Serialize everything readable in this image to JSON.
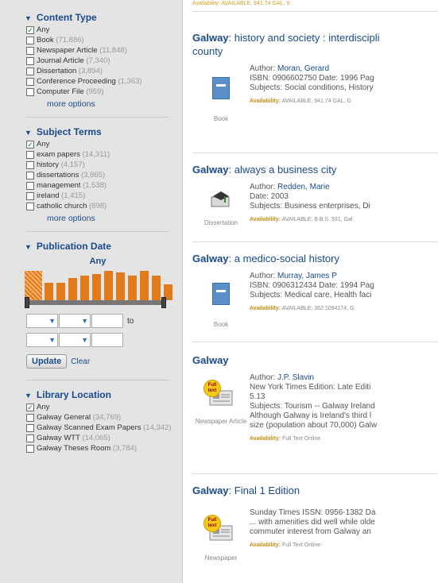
{
  "sidebar": {
    "content_type": {
      "title": "Content Type",
      "options": [
        {
          "label": "Any",
          "count": "",
          "checked": true
        },
        {
          "label": "Book",
          "count": "(71,886)",
          "checked": false
        },
        {
          "label": "Newspaper Article",
          "count": "(11,848)",
          "checked": false
        },
        {
          "label": "Journal Article",
          "count": "(7,340)",
          "checked": false
        },
        {
          "label": "Dissertation",
          "count": "(3,894)",
          "checked": false
        },
        {
          "label": "Conference Proceeding",
          "count": "(1,363)",
          "checked": false
        },
        {
          "label": "Computer File",
          "count": "(959)",
          "checked": false
        }
      ],
      "more": "more options"
    },
    "subject_terms": {
      "title": "Subject Terms",
      "options": [
        {
          "label": "Any",
          "count": "",
          "checked": true
        },
        {
          "label": "exam papers",
          "count": "(14,311)",
          "checked": false
        },
        {
          "label": "history",
          "count": "(4,157)",
          "checked": false
        },
        {
          "label": "dissertations",
          "count": "(3,865)",
          "checked": false
        },
        {
          "label": "management",
          "count": "(1,538)",
          "checked": false
        },
        {
          "label": "ireland",
          "count": "(1,415)",
          "checked": false
        },
        {
          "label": "catholic church",
          "count": "(898)",
          "checked": false
        }
      ],
      "more": "more options"
    },
    "publication_date": {
      "title": "Publication Date",
      "range_label": "Any",
      "histogram": [
        1.0,
        0.6,
        0.6,
        0.75,
        0.85,
        0.9,
        1.0,
        0.95,
        0.85,
        1.0,
        0.85,
        0.55
      ],
      "to_label": "to",
      "update_label": "Update",
      "clear_label": "Clear"
    },
    "library_location": {
      "title": "Library Location",
      "options": [
        {
          "label": "Any",
          "count": "",
          "checked": true
        },
        {
          "label": "Galway General",
          "count": "(34,769)",
          "checked": false
        },
        {
          "label": "Galway Scanned Exam Papers",
          "count": "(14,342)",
          "checked": false
        },
        {
          "label": "Galway WTT",
          "count": "(14,065)",
          "checked": false
        },
        {
          "label": "Galway Theses Room",
          "count": "(3,784)",
          "checked": false
        }
      ]
    }
  },
  "results": {
    "top_strip": "Availability: AVAILABLE, 941.74 GAL, 9",
    "records": [
      {
        "title_hl": "Galway",
        "title_rest": ": history and society : interdiscipli",
        "title_line2": "county",
        "format": "Book",
        "icon": "book-icon",
        "author_label": "Author:",
        "author": "Moran, Gerard",
        "lines": [
          "ISBN: 0906602750 Date: 1996 Pag",
          "Subjects: Social conditions, History"
        ],
        "availability_label": "Availability:",
        "availability": "AVAILABLE, 941.74 GAL, G"
      },
      {
        "title_hl": "Galway",
        "title_rest": ": always a business city",
        "title_line2": "",
        "format": "Dissertation",
        "icon": "dissertation-icon",
        "author_label": "Author:",
        "author": "Redden, Marie",
        "lines": [
          "Date: 2003",
          "Subjects: Business enterprises, Di"
        ],
        "availability_label": "Availability:",
        "availability": "AVAILABLE, B.B.S. 931, Gal"
      },
      {
        "title_hl": "Galway",
        "title_rest": ": a medico-social history",
        "title_line2": "",
        "format": "Book",
        "icon": "book-icon",
        "author_label": "Author:",
        "author": "Murray, James P",
        "lines": [
          "ISBN: 0906312434 Date: 1994 Pag",
          "Subjects: Medical care, Health faci"
        ],
        "availability_label": "Availability:",
        "availability": "AVAILABLE, 362.1094174, G"
      },
      {
        "title_hl": "Galway",
        "title_rest": "",
        "title_line2": "",
        "format": "Newspaper Article",
        "icon": "newspaper-icon",
        "badge": "Full text",
        "author_label": "Author:",
        "author": "J.P. Slavin",
        "lines": [
          "New York Times Edition: Late Editi",
          "5.13",
          "Subjects: Tourism -- Galway Ireland",
          "Although Galway is Ireland's third l",
          "size (population about 70,000) Galw"
        ],
        "availability_label": "Availability:",
        "availability": "Full Text Online"
      },
      {
        "title_hl": "Galway",
        "title_rest": ": Final 1 Edition",
        "title_line2": "",
        "format": "Newspaper",
        "icon": "newspaper-icon",
        "badge": "Full text",
        "author_label": "",
        "author": "",
        "lines": [
          "Sunday Times ISSN: 0956-1382 Da",
          "... with amenities did well while olde",
          "commuter interest from Galway an"
        ],
        "availability_label": "Availability:",
        "availability": "Full Text Online"
      }
    ]
  }
}
